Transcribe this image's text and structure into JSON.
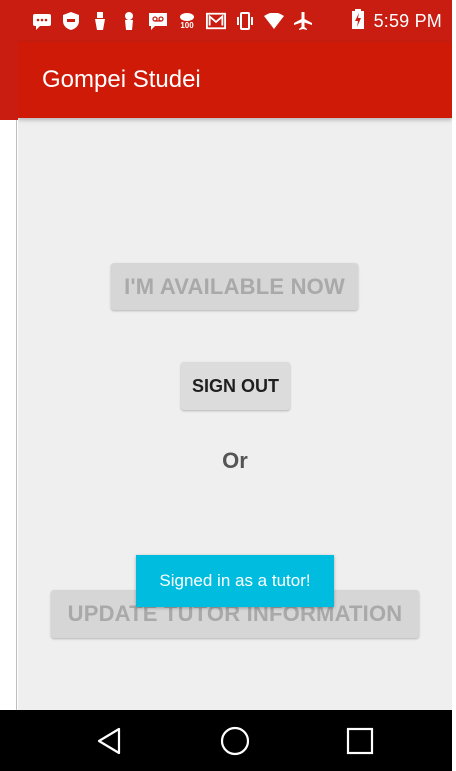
{
  "status_bar": {
    "time": "5:59 PM",
    "icons": [
      "message-icon",
      "shield-icon",
      "usb-icon",
      "keyhole-icon",
      "voicemail-icon",
      "cloud-100-icon",
      "gmail-icon",
      "vibrate-icon",
      "wifi-icon",
      "airplane-icon",
      "battery-charging-icon"
    ]
  },
  "app_bar": {
    "title": "Gompei Studei"
  },
  "main": {
    "available_button": "I'M AVAILABLE NOW",
    "sign_out_button": "SIGN OUT",
    "or_label": "Or",
    "update_button": "UPDATE TUTOR INFORMATION"
  },
  "toast": {
    "message": "Signed in as a tutor!"
  },
  "nav_bar": {
    "icons": [
      "back-icon",
      "home-icon",
      "recents-icon"
    ]
  },
  "colors": {
    "primary": "#cf1a08",
    "toast": "#00bde0",
    "background": "#efefef"
  }
}
